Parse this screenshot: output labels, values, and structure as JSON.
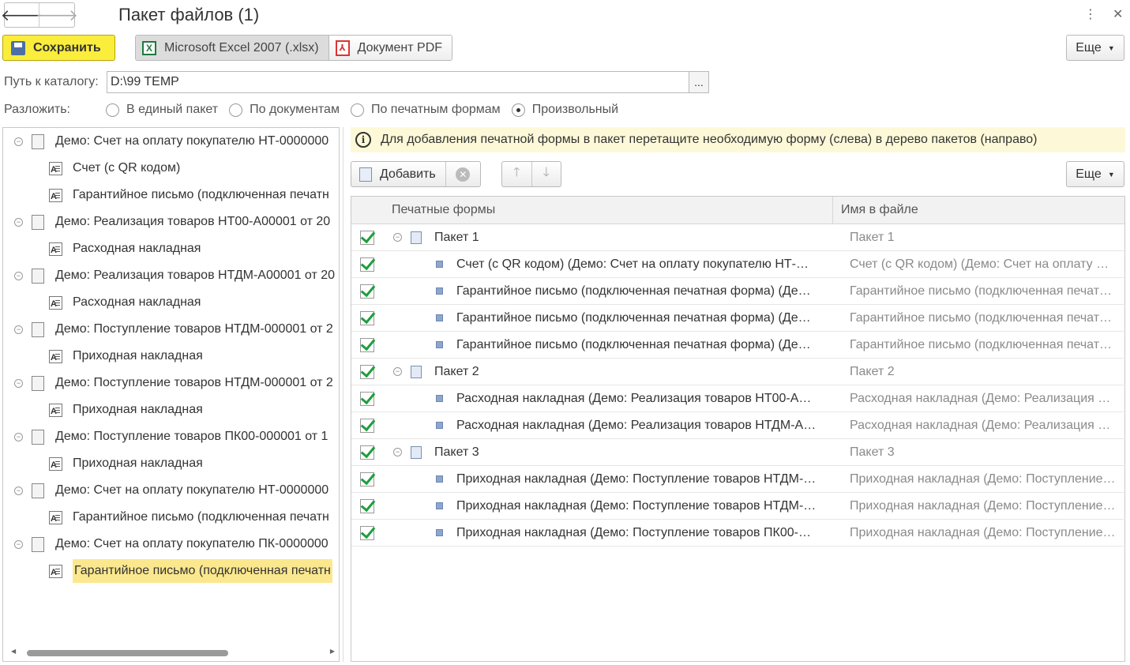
{
  "window": {
    "title": "Пакет файлов (1)",
    "back_glyph": "🡐",
    "forward_glyph": "🡒",
    "menu_glyph": "⋮",
    "close_glyph": "✕"
  },
  "toolbar": {
    "save_label": "Сохранить",
    "formats": [
      {
        "label": "Microsoft Excel 2007 (.xlsx)",
        "icon": "excel-icon",
        "selected": true
      },
      {
        "label": "Документ PDF",
        "icon": "pdf-icon",
        "selected": false
      }
    ],
    "more_label": "Еще"
  },
  "path": {
    "label": "Путь к каталогу:",
    "value": "D:\\99 TEMP",
    "browse_label": "..."
  },
  "split": {
    "label": "Разложить:",
    "options": [
      {
        "label": "В единый пакет",
        "selected": false
      },
      {
        "label": "По документам",
        "selected": false
      },
      {
        "label": "По печатным формам",
        "selected": false
      },
      {
        "label": "Произвольный",
        "selected": true
      }
    ]
  },
  "source_tree": [
    {
      "label": "Демо: Счет на оплату покупателю НТ-0000000",
      "level": 0
    },
    {
      "label": "Счет (с QR кодом)",
      "level": 1
    },
    {
      "label": "Гарантийное письмо (подключенная печатн",
      "level": 1
    },
    {
      "label": "Демо: Реализация товаров НТ00-А00001 от 20",
      "level": 0
    },
    {
      "label": "Расходная накладная",
      "level": 1
    },
    {
      "label": "Демо: Реализация товаров НТДМ-А00001 от 20",
      "level": 0
    },
    {
      "label": "Расходная накладная",
      "level": 1
    },
    {
      "label": "Демо: Поступление товаров НТДМ-000001 от 2",
      "level": 0
    },
    {
      "label": "Приходная накладная",
      "level": 1
    },
    {
      "label": "Демо: Поступление товаров НТДМ-000001 от 2",
      "level": 0
    },
    {
      "label": "Приходная накладная",
      "level": 1
    },
    {
      "label": "Демо: Поступление товаров ПК00-000001 от 1",
      "level": 0
    },
    {
      "label": "Приходная накладная",
      "level": 1
    },
    {
      "label": "Демо: Счет на оплату покупателю НТ-0000000",
      "level": 0
    },
    {
      "label": "Гарантийное письмо (подключенная печатн",
      "level": 1
    },
    {
      "label": "Демо: Счет на оплату покупателю ПК-0000000",
      "level": 0
    },
    {
      "label": "Гарантийное письмо (подключенная печатн",
      "level": 1,
      "selected": true
    }
  ],
  "info": {
    "text": "Для добавления печатной формы в пакет перетащите необходимую форму (слева) в дерево пакетов (направо)",
    "icon": "info-icon"
  },
  "packages_toolbar": {
    "add_label": "Добавить",
    "more_label": "Еще",
    "up_glyph": "🡑",
    "down_glyph": "🡓",
    "delete_glyph": "✕"
  },
  "table": {
    "columns": [
      "Печатные формы",
      "Имя в файле"
    ],
    "rows": [
      {
        "kind": "package",
        "checked": true,
        "name": "Пакет 1",
        "file": "Пакет 1"
      },
      {
        "kind": "form",
        "checked": true,
        "name": "Счет (с QR кодом) (Демо: Счет на оплату покупателю НТ-…",
        "file": "Счет (с QR кодом) (Демо: Счет на оплату …"
      },
      {
        "kind": "form",
        "checked": true,
        "name": "Гарантийное письмо (подключенная печатная форма) (Де…",
        "file": "Гарантийное письмо (подключенная печат…"
      },
      {
        "kind": "form",
        "checked": true,
        "name": "Гарантийное письмо (подключенная печатная форма) (Де…",
        "file": "Гарантийное письмо (подключенная печат…"
      },
      {
        "kind": "form",
        "checked": true,
        "name": "Гарантийное письмо (подключенная печатная форма) (Де…",
        "file": "Гарантийное письмо (подключенная печат…"
      },
      {
        "kind": "package",
        "checked": true,
        "name": "Пакет 2",
        "file": "Пакет 2"
      },
      {
        "kind": "form",
        "checked": true,
        "name": "Расходная накладная (Демо: Реализация товаров НТ00-А…",
        "file": "Расходная накладная (Демо: Реализация …"
      },
      {
        "kind": "form",
        "checked": true,
        "name": "Расходная накладная (Демо: Реализация товаров НТДМ-А…",
        "file": "Расходная накладная (Демо: Реализация …"
      },
      {
        "kind": "package",
        "checked": true,
        "name": "Пакет 3",
        "file": "Пакет 3"
      },
      {
        "kind": "form",
        "checked": true,
        "name": "Приходная накладная (Демо: Поступление товаров НТДМ-…",
        "file": "Приходная накладная (Демо: Поступление…"
      },
      {
        "kind": "form",
        "checked": true,
        "name": "Приходная накладная (Демо: Поступление товаров НТДМ-…",
        "file": "Приходная накладная (Демо: Поступление…"
      },
      {
        "kind": "form",
        "checked": true,
        "name": "Приходная накладная (Демо: Поступление товаров ПК00-…",
        "file": "Приходная накладная (Демо: Поступление…"
      }
    ]
  }
}
